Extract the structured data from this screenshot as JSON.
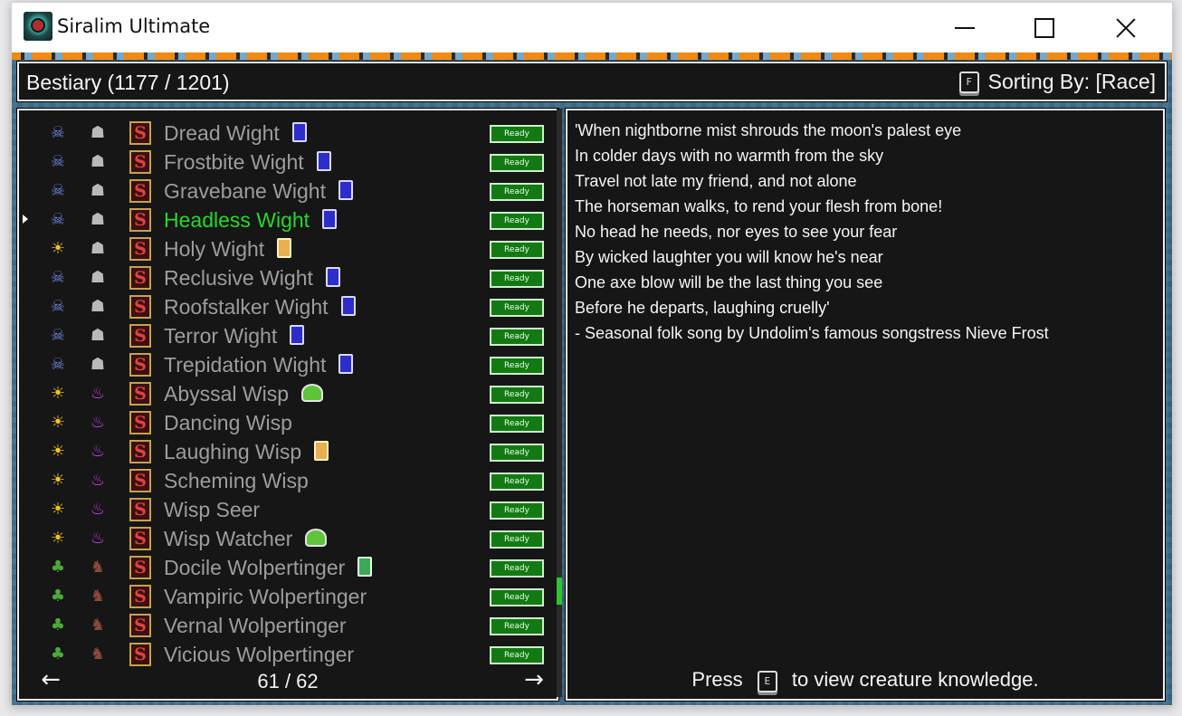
{
  "window": {
    "title": "Siralim Ultimate"
  },
  "header": {
    "title": "Bestiary (1177 / 1201)",
    "sort_key": "F",
    "sort_label": "Sorting By: [Race]"
  },
  "list": {
    "items": [
      {
        "name": "Dread Wight",
        "element": "death",
        "family": "wight",
        "trait": "death",
        "status": "Ready",
        "selected": false
      },
      {
        "name": "Frostbite Wight",
        "element": "death",
        "family": "wight",
        "trait": "death",
        "status": "Ready",
        "selected": false
      },
      {
        "name": "Gravebane Wight",
        "element": "death",
        "family": "wight",
        "trait": "death",
        "status": "Ready",
        "selected": false
      },
      {
        "name": "Headless Wight",
        "element": "death",
        "family": "wight",
        "trait": "death",
        "status": "Ready",
        "selected": true
      },
      {
        "name": "Holy Wight",
        "element": "life",
        "family": "wight",
        "trait": "life",
        "status": "Ready",
        "selected": false
      },
      {
        "name": "Reclusive Wight",
        "element": "death",
        "family": "wight",
        "trait": "death",
        "status": "Ready",
        "selected": false
      },
      {
        "name": "Roofstalker Wight",
        "element": "death",
        "family": "wight",
        "trait": "death",
        "status": "Ready",
        "selected": false
      },
      {
        "name": "Terror Wight",
        "element": "death",
        "family": "wight",
        "trait": "death",
        "status": "Ready",
        "selected": false
      },
      {
        "name": "Trepidation Wight",
        "element": "death",
        "family": "wight",
        "trait": "death",
        "status": "Ready",
        "selected": false
      },
      {
        "name": "Abyssal Wisp",
        "element": "life",
        "family": "wisp",
        "trait": "slime",
        "status": "Ready",
        "selected": false
      },
      {
        "name": "Dancing Wisp",
        "element": "life",
        "family": "wisp",
        "trait": "",
        "status": "Ready",
        "selected": false
      },
      {
        "name": "Laughing Wisp",
        "element": "life",
        "family": "wisp",
        "trait": "life",
        "status": "Ready",
        "selected": false
      },
      {
        "name": "Scheming Wisp",
        "element": "life",
        "family": "wisp",
        "trait": "",
        "status": "Ready",
        "selected": false
      },
      {
        "name": "Wisp Seer",
        "element": "life",
        "family": "wisp",
        "trait": "",
        "status": "Ready",
        "selected": false
      },
      {
        "name": "Wisp Watcher",
        "element": "life",
        "family": "wisp",
        "trait": "slime",
        "status": "Ready",
        "selected": false
      },
      {
        "name": "Docile Wolpertinger",
        "element": "nature",
        "family": "wolpertinger",
        "trait": "leaf",
        "status": "Ready",
        "selected": false
      },
      {
        "name": "Vampiric Wolpertinger",
        "element": "nature",
        "family": "wolpertinger",
        "trait": "",
        "status": "Ready",
        "selected": false
      },
      {
        "name": "Vernal Wolpertinger",
        "element": "nature",
        "family": "wolpertinger",
        "trait": "",
        "status": "Ready",
        "selected": false
      },
      {
        "name": "Vicious Wolpertinger",
        "element": "nature",
        "family": "wolpertinger",
        "trait": "",
        "status": "Ready",
        "selected": false
      }
    ],
    "skill_glyph": "S",
    "pager": {
      "prev": "←",
      "page": "61 / 62",
      "next": "→"
    }
  },
  "lore": {
    "lines": [
      "'When nightborne mist shrouds the moon's palest eye",
      "In colder days with no warmth from the sky",
      "Travel not late my friend, and not alone",
      "The horseman walks, to rend your flesh from bone!",
      "No head he needs, nor eyes to see your fear",
      "By wicked laughter you will know he's near",
      "One axe blow will be the last thing you see",
      "Before he departs, laughing cruelly'",
      "- Seasonal folk song by Undolim's famous songstress Nieve Frost"
    ],
    "press_prefix": "Press",
    "press_key": "E",
    "press_suffix": "to view creature knowledge."
  },
  "icons": {
    "element_death": "skull-orb-icon",
    "element_life": "sun-icon",
    "element_nature": "leaf-icon",
    "family_wight": "wight-head-icon",
    "family_wisp": "flame-icon",
    "family_wolpertinger": "horned-rabbit-icon"
  },
  "colors": {
    "selected_name": "#27d82a",
    "ready_badge": "#137a13",
    "panel_bg": "#161616"
  }
}
